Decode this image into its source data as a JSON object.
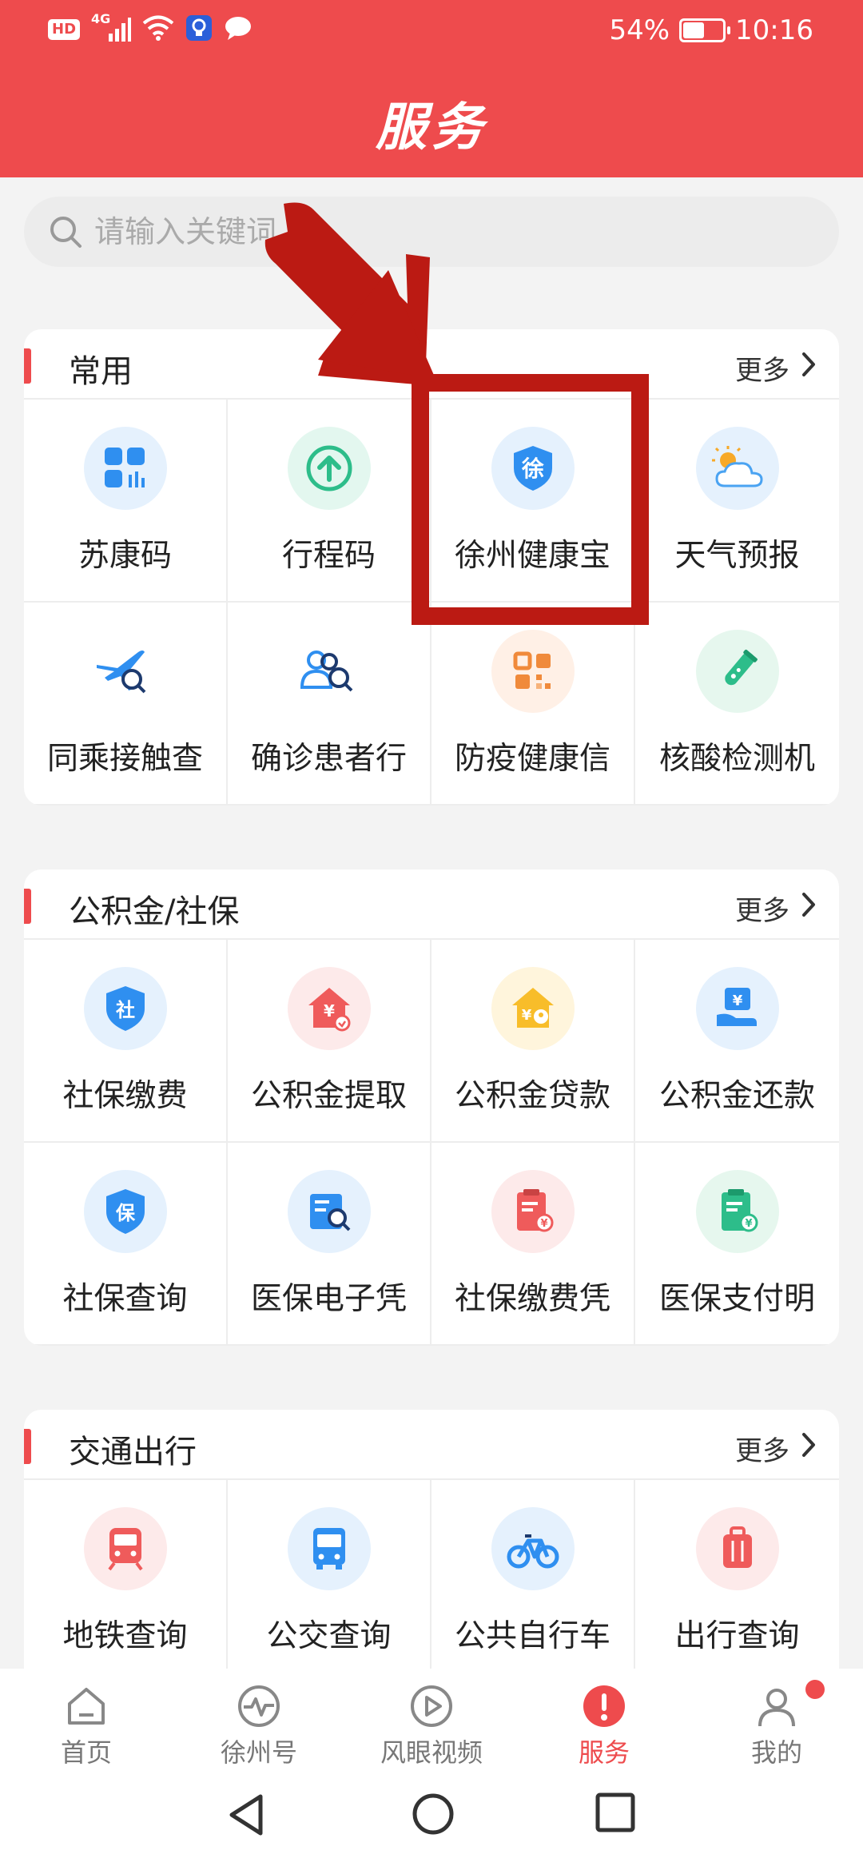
{
  "status_bar": {
    "hd": "HD",
    "network": "4G",
    "battery": "54%",
    "battery_level": 0.54,
    "time": "10:16"
  },
  "header": {
    "title": "服务"
  },
  "search": {
    "placeholder": "请输入关键词"
  },
  "sections": [
    {
      "title": "常用",
      "more": "更多",
      "items": [
        {
          "label": "苏康码",
          "icon": "grid-code-icon",
          "bg": "#e5f1fd"
        },
        {
          "label": "行程码",
          "icon": "upload-arrow-icon",
          "bg": "#e3f7ef"
        },
        {
          "label": "徐州健康宝",
          "icon": "shield-xu-icon",
          "bg": "#e5f1fd"
        },
        {
          "label": "天气预报",
          "icon": "sun-cloud-icon",
          "bg": "#e5f1fd"
        },
        {
          "label": "同乘接触查",
          "icon": "plane-search-icon",
          "bg": "#ffffff"
        },
        {
          "label": "确诊患者行",
          "icon": "people-search-icon",
          "bg": "#ffffff"
        },
        {
          "label": "防疫健康信",
          "icon": "qr-code-icon",
          "bg": "#fff0e6"
        },
        {
          "label": "核酸检测机",
          "icon": "test-tube-icon",
          "bg": "#e6f7ee"
        }
      ]
    },
    {
      "title": "公积金/社保",
      "more": "更多",
      "items": [
        {
          "label": "社保缴费",
          "icon": "shield-she-icon",
          "bg": "#e5f1fd"
        },
        {
          "label": "公积金提取",
          "icon": "house-withdraw-icon",
          "bg": "#fdeaea"
        },
        {
          "label": "公积金贷款",
          "icon": "house-loan-icon",
          "bg": "#fff5dc"
        },
        {
          "label": "公积金还款",
          "icon": "hand-yen-icon",
          "bg": "#e5f1fd"
        },
        {
          "label": "社保查询",
          "icon": "shield-bao-icon",
          "bg": "#e5f1fd"
        },
        {
          "label": "医保电子凭",
          "icon": "card-search-icon",
          "bg": "#e5f1fd"
        },
        {
          "label": "社保缴费凭",
          "icon": "receipt-yen-icon",
          "bg": "#fdeaea"
        },
        {
          "label": "医保支付明",
          "icon": "clipboard-yen-icon",
          "bg": "#e6f7ee"
        }
      ]
    },
    {
      "title": "交通出行",
      "more": "更多",
      "items": [
        {
          "label": "地铁查询",
          "icon": "subway-icon",
          "bg": "#fdeaea"
        },
        {
          "label": "公交查询",
          "icon": "bus-icon",
          "bg": "#e5f1fd"
        },
        {
          "label": "公共自行车",
          "icon": "bicycle-icon",
          "bg": "#e5f1fd"
        },
        {
          "label": "出行查询",
          "icon": "suitcase-icon",
          "bg": "#fdeaea"
        }
      ]
    }
  ],
  "bottom_nav": [
    {
      "label": "首页",
      "icon": "home-icon",
      "active": false
    },
    {
      "label": "徐州号",
      "icon": "pulse-icon",
      "active": false
    },
    {
      "label": "风眼视频",
      "icon": "play-icon",
      "active": false
    },
    {
      "label": "服务",
      "icon": "service-alert-icon",
      "active": true
    },
    {
      "label": "我的",
      "icon": "person-icon",
      "active": false
    }
  ],
  "colors": {
    "brand": "#ee4b4d",
    "annotation": "#bb1a13"
  }
}
